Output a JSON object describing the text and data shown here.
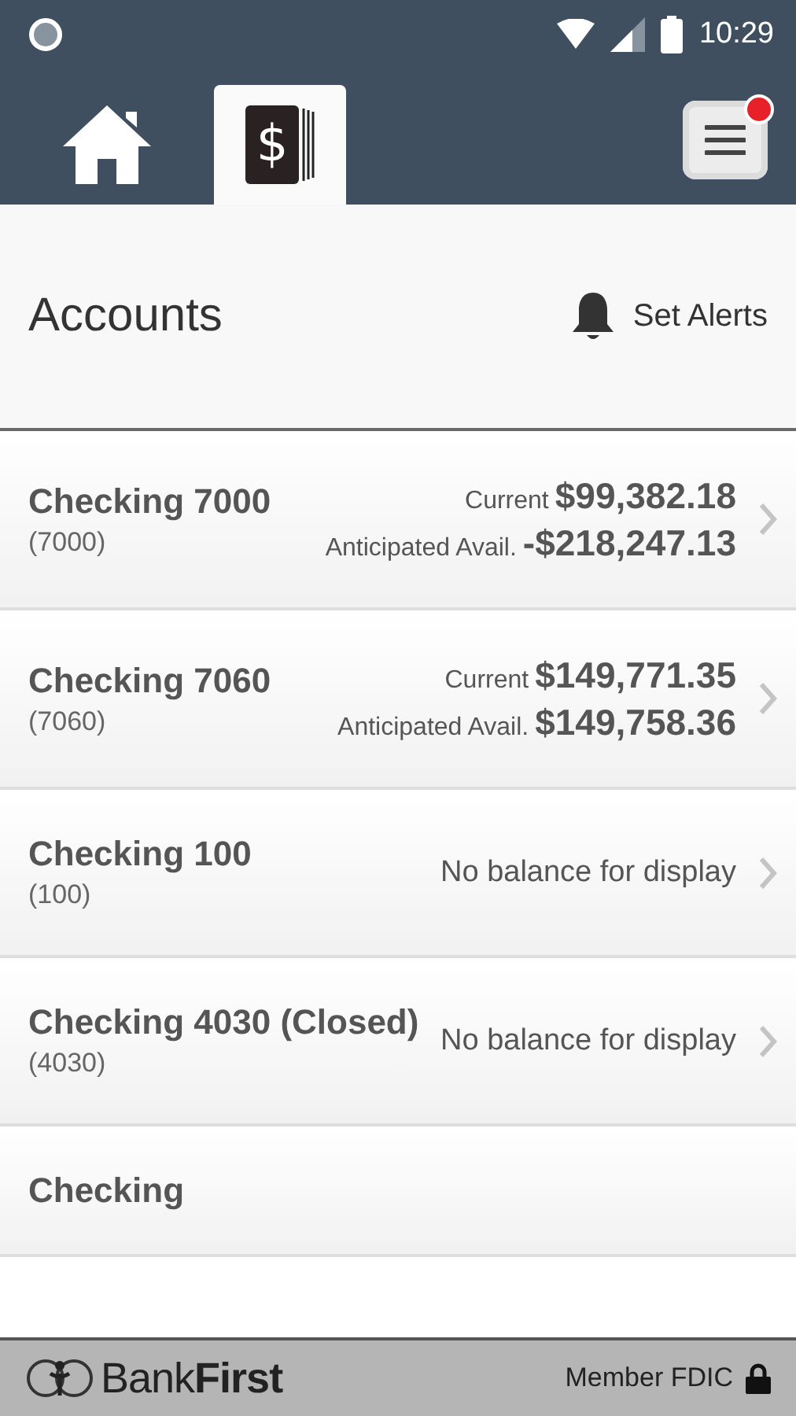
{
  "status_bar": {
    "time": "10:29"
  },
  "nav": {
    "tabs": [
      {
        "kind": "home",
        "selected": false
      },
      {
        "kind": "accounts",
        "selected": true,
        "symbol": "$"
      }
    ],
    "menu": {
      "notification": true
    }
  },
  "header": {
    "title": "Accounts",
    "alerts_button": "Set Alerts"
  },
  "accounts": [
    {
      "kind": "balances",
      "name": "Checking 7000",
      "number": "(7000)",
      "balances": [
        {
          "label": "Current",
          "amount": "$99,382.18"
        },
        {
          "label": "Anticipated Avail.",
          "amount": "-$218,247.13"
        }
      ]
    },
    {
      "kind": "balances",
      "name": "Checking 7060",
      "number": "(7060)",
      "balances": [
        {
          "label": "Current",
          "amount": "$149,771.35"
        },
        {
          "label": "Anticipated Avail.",
          "amount": "$149,758.36"
        }
      ]
    },
    {
      "kind": "message",
      "name": "Checking 100",
      "number": "(100)",
      "message": "No balance for display"
    },
    {
      "kind": "message",
      "name": "Checking 4030 (Closed)",
      "number": "(4030)",
      "message": "No balance for display"
    },
    {
      "kind": "partial",
      "name": "Checking"
    }
  ],
  "footer": {
    "brand_plain": "Bank",
    "brand_bold": "First",
    "member": "Member FDIC"
  }
}
